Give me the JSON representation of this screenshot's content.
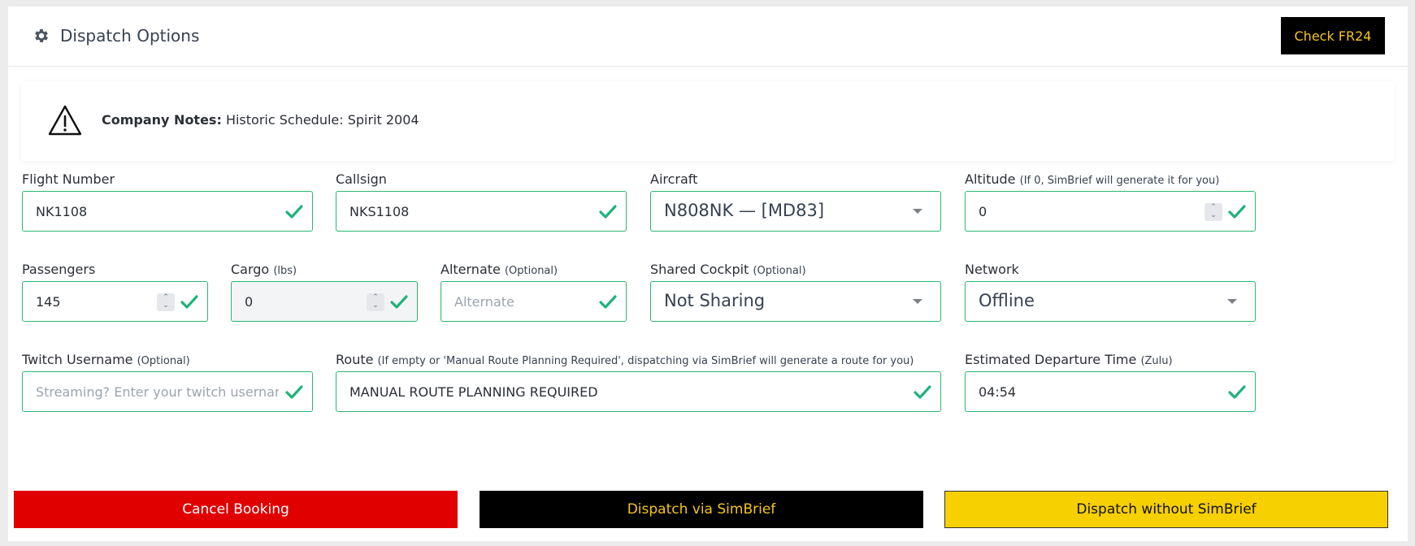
{
  "header": {
    "title": "Dispatch Options",
    "fr24_label": "Check FR24"
  },
  "notes": {
    "label": "Company Notes:",
    "text": "Historic Schedule: Spirit 2004"
  },
  "fields": {
    "flight_number": {
      "label": "Flight Number",
      "value": "NK1108"
    },
    "callsign": {
      "label": "Callsign",
      "value": "NKS1108"
    },
    "aircraft": {
      "label": "Aircraft",
      "value": "N808NK — [MD83]"
    },
    "altitude": {
      "label": "Altitude",
      "hint": "(If 0, SimBrief will generate it for you)",
      "value": "0"
    },
    "passengers": {
      "label": "Passengers",
      "value": "145"
    },
    "cargo": {
      "label": "Cargo",
      "hint": "(lbs)",
      "value": "0"
    },
    "alternate": {
      "label": "Alternate",
      "hint": "(Optional)",
      "placeholder": "Alternate"
    },
    "shared_cockpit": {
      "label": "Shared Cockpit",
      "hint": "(Optional)",
      "value": "Not Sharing"
    },
    "network": {
      "label": "Network",
      "value": "Offline"
    },
    "twitch": {
      "label": "Twitch Username",
      "hint": "(Optional)",
      "placeholder": "Streaming? Enter your twitch username"
    },
    "route": {
      "label": "Route",
      "hint": "(If empty or 'Manual Route Planning Required', dispatching via SimBrief will generate a route for you)",
      "value": "MANUAL ROUTE PLANNING REQUIRED"
    },
    "departure": {
      "label": "Estimated Departure Time",
      "hint": "(Zulu)",
      "value": "04:54"
    }
  },
  "buttons": {
    "cancel": "Cancel Booking",
    "simbrief": "Dispatch via SimBrief",
    "no_simbrief": "Dispatch without SimBrief"
  },
  "colors": {
    "valid_border": "#2bb673",
    "cancel_bg": "#e00000",
    "simbrief_bg": "#000000",
    "accent_yellow": "#f7d000"
  }
}
